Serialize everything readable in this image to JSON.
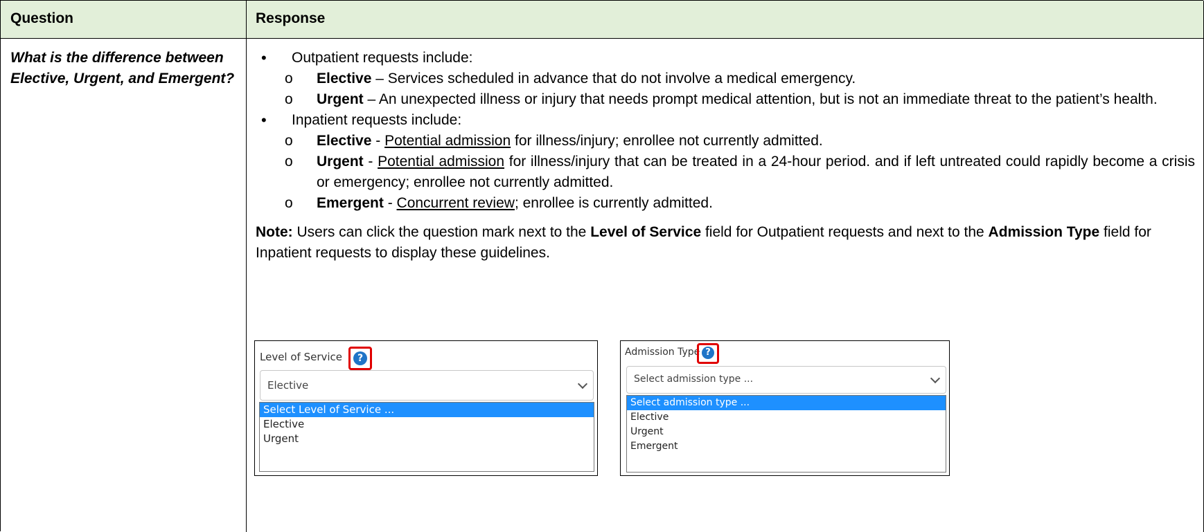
{
  "header": {
    "question": "Question",
    "response": "Response"
  },
  "question": "What is the difference between Elective, Urgent, and Emergent?",
  "outpatient": {
    "intro": "Outpatient requests include:",
    "items": [
      {
        "term": "Elective",
        "sep": " – ",
        "pre": "",
        "link": "",
        "text": "Services scheduled in advance that do not involve a medical emergency."
      },
      {
        "term": "Urgent",
        "sep": " – ",
        "pre": "",
        "link": "",
        "text": "An unexpected illness or injury that needs prompt medical attention, but is not an immediate threat to the patient’s health."
      }
    ]
  },
  "inpatient": {
    "intro": "Inpatient requests include:",
    "items": [
      {
        "term": "Elective",
        "sep": " - ",
        "link": "Potential admission",
        "text": " for illness/injury; enrollee not currently admitted."
      },
      {
        "term": "Urgent",
        "sep": " - ",
        "link": "Potential admission",
        "text": " for illness/injury that can be treated in a 24-hour period. and if left untreated could rapidly become a crisis or emergency; enrollee not currently admitted."
      },
      {
        "term": "Emergent",
        "sep": " - ",
        "link": "Concurrent review",
        "text": "; enrollee is currently admitted."
      }
    ]
  },
  "note": {
    "label": "Note:",
    "t1": " Users can click the question mark next to the ",
    "b1": "Level of Service",
    "t2": " field for Outpatient requests and next to the ",
    "b2": "Admission Type",
    "t3": " field for Inpatient requests to display these guidelines."
  },
  "level_of_service": {
    "label": "Level of Service",
    "selected": "Elective",
    "options": [
      "Select Level of Service ...",
      "Elective",
      "Urgent"
    ]
  },
  "admission_type": {
    "label": "Admission Type",
    "placeholder": "Select admission type ...",
    "options": [
      "Select admission type ...",
      "Elective",
      "Urgent",
      "Emergent"
    ]
  },
  "help_icon_glyph": "?",
  "colors": {
    "header_bg": "#e2efd9",
    "highlight": "#e00000",
    "help_icon": "#1f74c7",
    "option_active": "#1e90ff"
  }
}
